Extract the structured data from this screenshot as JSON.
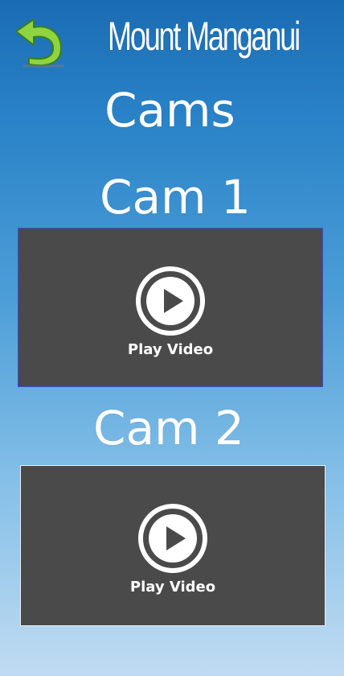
{
  "header": {
    "title": "Mount Manganui",
    "subtitle": "Cams",
    "back_icon": "back-arrow-icon"
  },
  "cams": [
    {
      "label": "Cam 1",
      "play_label": "Play Video",
      "icon": "play-icon"
    },
    {
      "label": "Cam 2",
      "play_label": "Play Video",
      "icon": "play-icon"
    }
  ],
  "colors": {
    "gradient_top": "#1a6cb3",
    "gradient_bottom": "#c0dbf2",
    "player_background": "#4a4a4a",
    "back_arrow": "#8fd43f",
    "text": "#ffffff"
  }
}
